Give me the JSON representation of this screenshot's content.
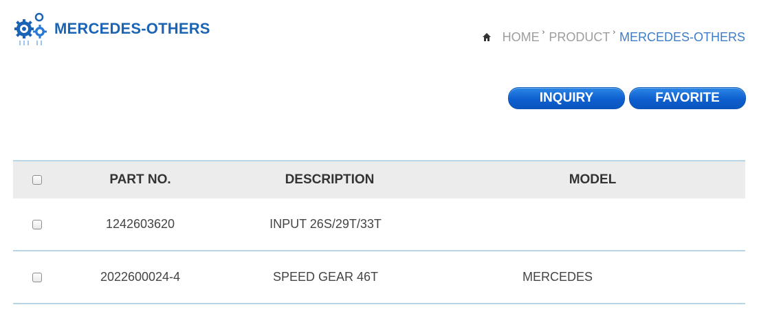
{
  "header": {
    "title": "MERCEDES-OTHERS",
    "logo_icon": "gears-icon"
  },
  "breadcrumb": {
    "home_icon": "home-icon",
    "items": [
      "HOME",
      "PRODUCT",
      "MERCEDES-OTHERS"
    ],
    "separator": "›"
  },
  "actions": {
    "inquiry_label": "INQUIRY",
    "favorite_label": "FAVORITE",
    "color": "#0e5fcf"
  },
  "table": {
    "columns": [
      "PART NO.",
      "DESCRIPTION",
      "MODEL"
    ],
    "rows": [
      {
        "part_no": "1242603620",
        "description": "INPUT 26S/29T/33T",
        "model": ""
      },
      {
        "part_no": "2022600024-4",
        "description": "SPEED GEAR 46T",
        "model": "MERCEDES"
      }
    ]
  },
  "colors": {
    "title": "#1a63b5",
    "breadcrumb_current": "#3d7cc9",
    "table_divider": "#b7d5e6",
    "header_bg": "#ececec"
  }
}
